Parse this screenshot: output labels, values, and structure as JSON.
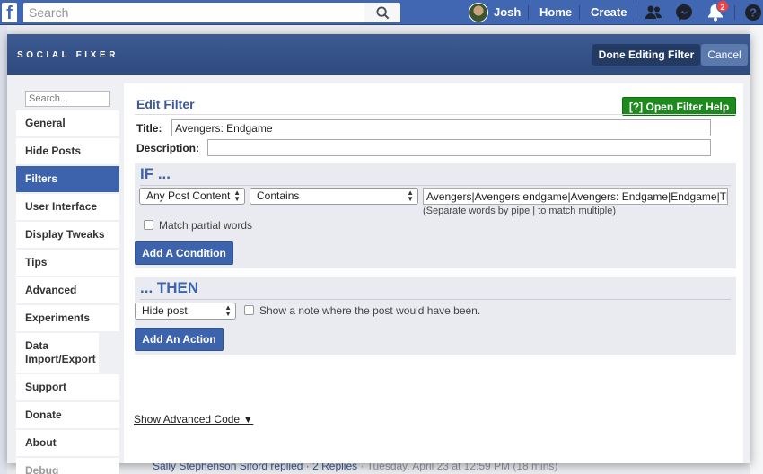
{
  "fb": {
    "logo": "f",
    "search_placeholder": "Search",
    "user_name": "Josh",
    "nav_home": "Home",
    "nav_create": "Create",
    "notification_count": "2",
    "icons": [
      "search-icon",
      "friends-icon",
      "messenger-icon",
      "bell-icon",
      "help-icon"
    ]
  },
  "dialog": {
    "brand": "SOCIAL FIXER",
    "done_label": "Done Editing Filter",
    "cancel_label": "Cancel"
  },
  "sidebar": {
    "search_placeholder": "Search...",
    "items": [
      {
        "label": "General"
      },
      {
        "label": "Hide Posts"
      },
      {
        "label": "Filters",
        "active": true
      },
      {
        "label": "User Interface"
      },
      {
        "label": "Display Tweaks"
      },
      {
        "label": "Tips"
      },
      {
        "label": "Advanced"
      },
      {
        "label": "Experiments"
      },
      {
        "label": "Data Import/Export"
      },
      {
        "label": "Support"
      },
      {
        "label": "Donate"
      },
      {
        "label": "About"
      },
      {
        "label": "Debug",
        "disabled": true
      }
    ]
  },
  "editor": {
    "heading": "Edit Filter",
    "help_button": "[?] Open Filter Help",
    "title_label": "Title:",
    "title_value": "Avengers: Endgame",
    "description_label": "Description:",
    "description_value": "",
    "if": {
      "heading": "IF ...",
      "field_select": "Any Post Content",
      "operator_select": "Contains",
      "match_value": "Avengers|Avengers endgame|Avengers: Endgame|Endgame|Th",
      "hint": "(Separate words by pipe | to match multiple)",
      "partial_label": "Match partial words",
      "partial_checked": false,
      "add_condition": "Add A Condition"
    },
    "then": {
      "heading": "... THEN",
      "action_select": "Hide post",
      "note_label": "Show a note where the post would have been.",
      "note_checked": false,
      "add_action": "Add An Action"
    },
    "advanced_link": "Show Advanced Code ▼"
  },
  "background": {
    "reply_text": "Sally Stephenson Siford replied · 2 Replies",
    "timestamp": "· Tuesday, April 23 at 12:59 PM (18 mins)"
  },
  "colors": {
    "facebook_blue": "#4267b2",
    "header_dark": "#2e4a7e",
    "accent_blue": "#3d63ad",
    "help_green": "#1d8a1d",
    "badge_red": "#fa3e3e"
  }
}
